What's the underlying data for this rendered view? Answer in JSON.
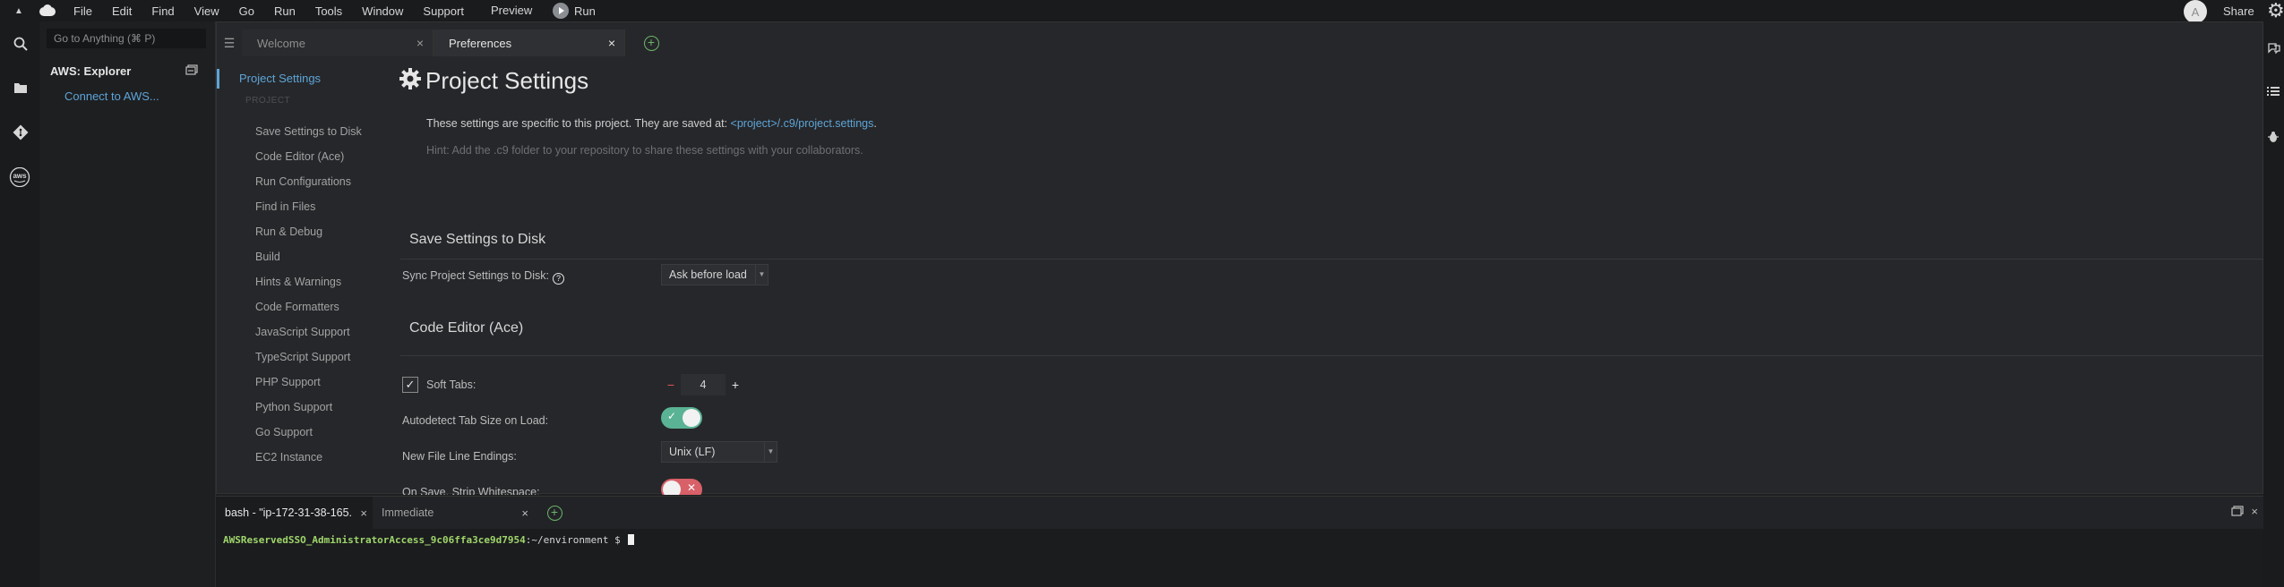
{
  "menubar": {
    "items": [
      "File",
      "Edit",
      "Find",
      "View",
      "Go",
      "Run",
      "Tools",
      "Window",
      "Support"
    ],
    "preview": "Preview",
    "run": "Run",
    "avatar_letter": "A",
    "share": "Share"
  },
  "explorer": {
    "goto_placeholder": "Go to Anything (⌘ P)",
    "title": "AWS: Explorer",
    "connect": "Connect to AWS..."
  },
  "tabs": [
    {
      "label": "Welcome",
      "active": false
    },
    {
      "label": "Preferences",
      "active": true
    }
  ],
  "pref_nav": {
    "active": "Project Settings",
    "section": "PROJECT",
    "items": [
      "Save Settings to Disk",
      "Code Editor (Ace)",
      "Run Configurations",
      "Find in Files",
      "Run & Debug",
      "Build",
      "Hints & Warnings",
      "Code Formatters",
      "JavaScript Support",
      "TypeScript Support",
      "PHP Support",
      "Python Support",
      "Go Support",
      "EC2 Instance"
    ]
  },
  "settings": {
    "title": "Project Settings",
    "desc_prefix": "These settings are specific to this project. They are saved at:",
    "desc_link": "<project>/.c9/project.settings",
    "desc_suffix": ".",
    "hint": "Hint: Add the .c9 folder to your repository to share these settings with your collaborators.",
    "save_section": "Save Settings to Disk",
    "sync_label": "Sync Project Settings to Disk:",
    "sync_value": "Ask before load",
    "ace_section": "Code Editor (Ace)",
    "soft_tabs_label": "Soft Tabs:",
    "soft_tabs_checked": true,
    "soft_tabs_value": "4",
    "autodetect_label": "Autodetect Tab Size on Load:",
    "autodetect_on": true,
    "line_endings_label": "New File Line Endings:",
    "line_endings_value": "Unix (LF)",
    "strip_label": "On Save, Strip Whitespace:",
    "strip_on": false
  },
  "terminal": {
    "tab_bash": "bash - \"ip-172-31-38-165.",
    "tab_immediate": "Immediate",
    "prompt_user": "AWSReservedSSO_AdministratorAccess_9c06ffa3ce9d7954",
    "prompt_path": ":~/environment $"
  },
  "colors": {
    "accent": "#5da5d8",
    "toggle_on": "#5ab394",
    "toggle_off": "#d86068",
    "prompt_green": "#9fd66b"
  }
}
